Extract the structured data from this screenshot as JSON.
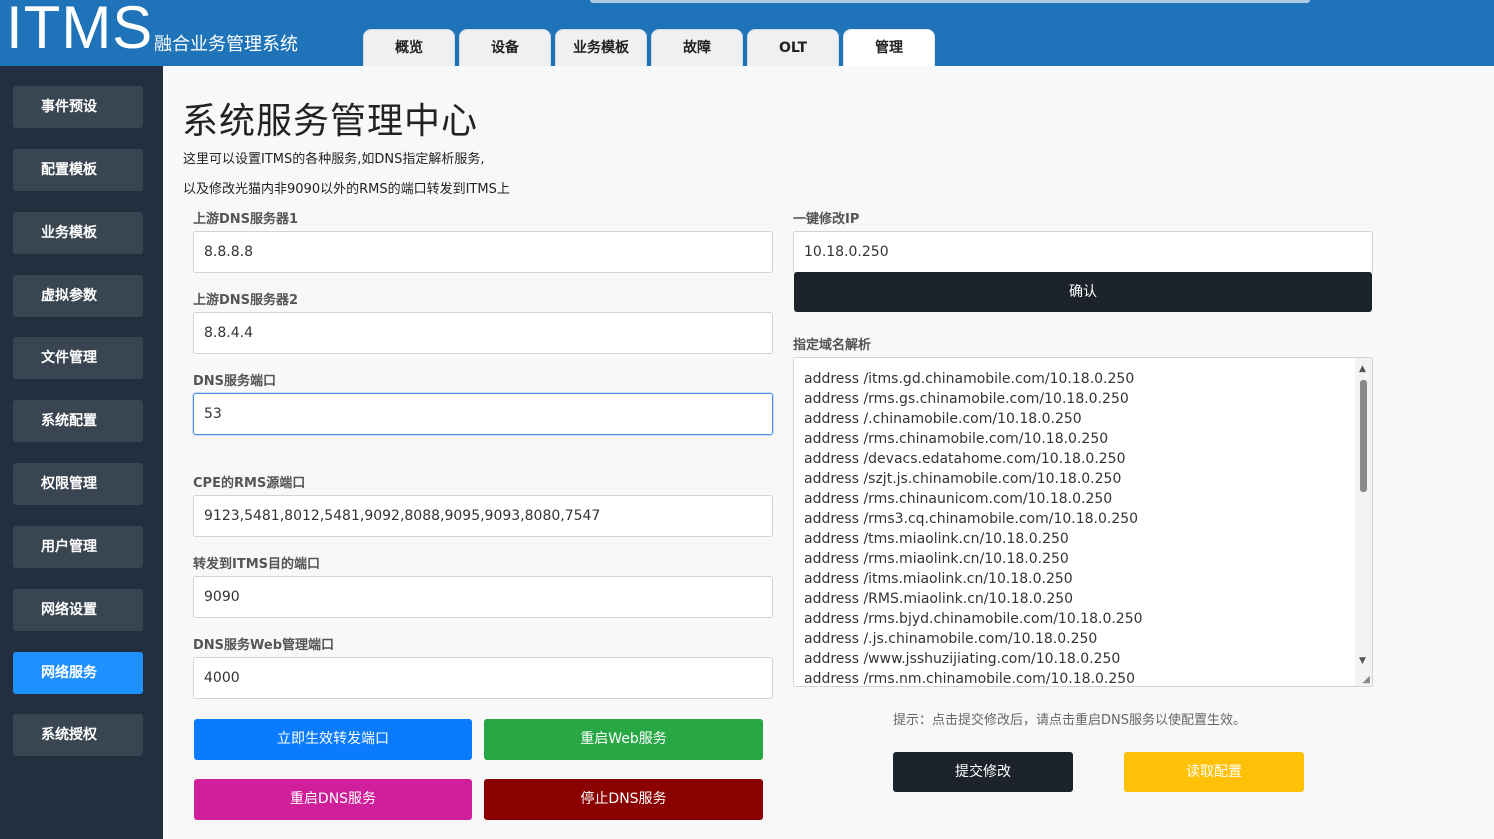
{
  "header": {
    "logo": "ITMS",
    "subtitle": "融合业务管理系统",
    "tabs": [
      "概览",
      "设备",
      "业务模板",
      "故障",
      "OLT",
      "管理"
    ],
    "active_tab": "管理"
  },
  "sidebar": {
    "items": [
      "事件预设",
      "配置模板",
      "业务模板",
      "虚拟参数",
      "文件管理",
      "系统配置",
      "权限管理",
      "用户管理",
      "网络设置",
      "网络服务",
      "系统授权"
    ],
    "active_item": "网络服务"
  },
  "main": {
    "title": "系统服务管理中心",
    "desc1": "这里可以设置ITMS的各种服务,如DNS指定解析服务,",
    "desc2": "以及修改光猫内非9090以外的RMS的端口转发到ITMS上",
    "dns1_label": "上游DNS服务器1",
    "dns1_value": "8.8.8.8",
    "dns2_label": "上游DNS服务器2",
    "dns2_value": "8.8.4.4",
    "dns_port_label": "DNS服务端口",
    "dns_port_value": "53",
    "cpe_label": "CPE的RMS源端口",
    "cpe_value": "9123,5481,8012,5481,9092,8088,9095,9093,8080,7547",
    "forward_label": "转发到ITMS目的端口",
    "forward_value": "9090",
    "web_port_label": "DNS服务Web管理端口",
    "web_port_value": "4000",
    "btn_apply_forward": "立即生效转发端口",
    "btn_restart_web": "重启Web服务",
    "btn_restart_dns": "重启DNS服务",
    "btn_stop_dns": "停止DNS服务",
    "ip_label": "一键修改IP",
    "ip_value": "10.18.0.250",
    "btn_confirm": "确认",
    "domain_label": "指定域名解析",
    "domain_lines": [
      "address /itms.gd.chinamobile.com/10.18.0.250",
      "address /rms.gs.chinamobile.com/10.18.0.250",
      "address /.chinamobile.com/10.18.0.250",
      "address /rms.chinamobile.com/10.18.0.250",
      "address /devacs.edatahome.com/10.18.0.250",
      "address /szjt.js.chinamobile.com/10.18.0.250",
      "address /rms.chinaunicom.com/10.18.0.250",
      "address /rms3.cq.chinamobile.com/10.18.0.250",
      "address /tms.miaolink.cn/10.18.0.250",
      "address /rms.miaolink.cn/10.18.0.250",
      "address /itms.miaolink.cn/10.18.0.250",
      "address /RMS.miaolink.cn/10.18.0.250",
      "address /rms.bjyd.chinamobile.com/10.18.0.250",
      "address /.js.chinamobile.com/10.18.0.250",
      "address /www.jsshuzijiating.com/10.18.0.250",
      "address /rms.nm.chinamobile.com/10.18.0.250"
    ],
    "hint": "提示：点击提交修改后，请点击重启DNS服务以使配置生效。",
    "btn_submit": "提交修改",
    "btn_read": "读取配置"
  }
}
